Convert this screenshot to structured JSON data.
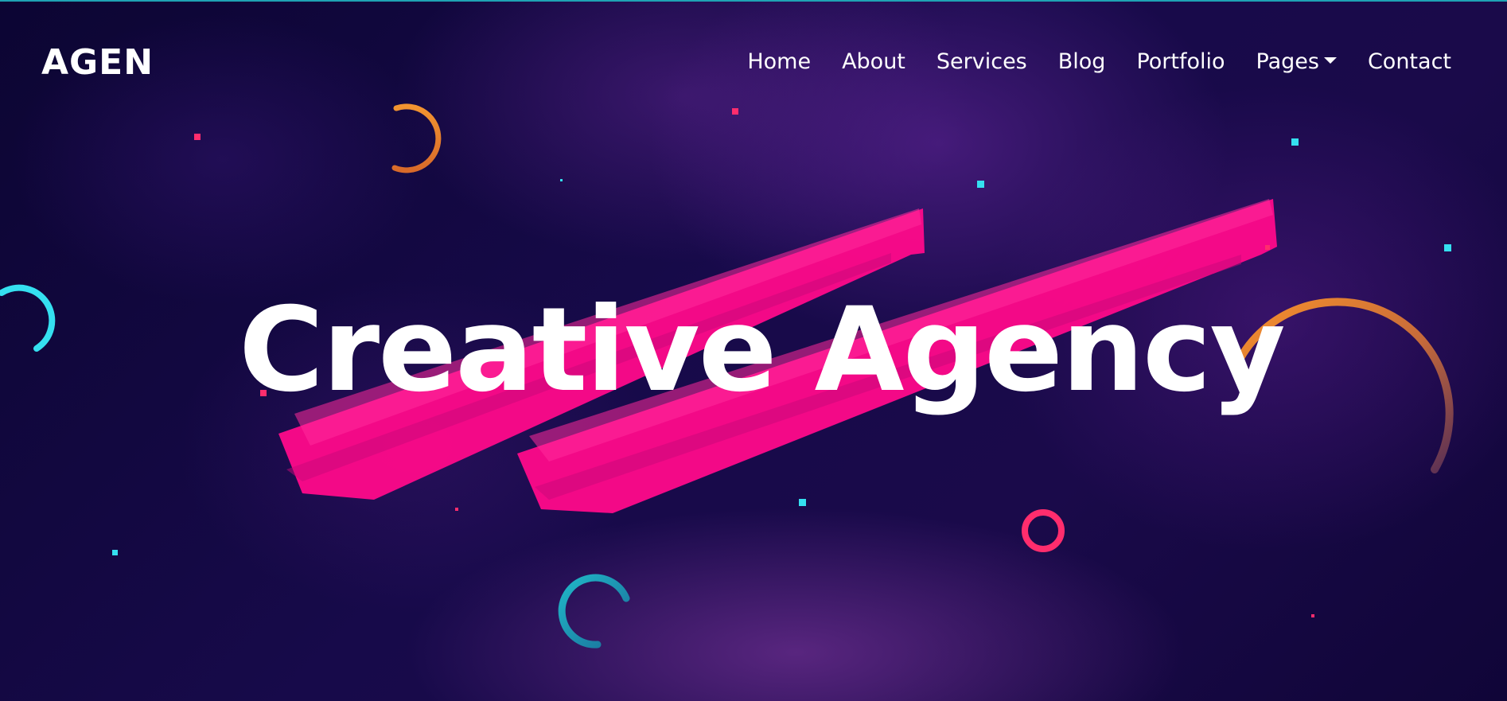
{
  "brand": {
    "logo_text": "AGEN"
  },
  "nav": {
    "items": [
      {
        "label": "Home"
      },
      {
        "label": "About"
      },
      {
        "label": "Services"
      },
      {
        "label": "Blog"
      },
      {
        "label": "Portfolio"
      },
      {
        "label": "Pages",
        "has_dropdown": true
      },
      {
        "label": "Contact"
      }
    ]
  },
  "hero": {
    "headline": "Creative Agency"
  },
  "colors": {
    "background": "#0d0638",
    "brush": "#ff0a8a",
    "orange": "#f28a2a",
    "cyan": "#35e0f0",
    "pink": "#ff2d6d",
    "teal": "#1fa3b4"
  }
}
